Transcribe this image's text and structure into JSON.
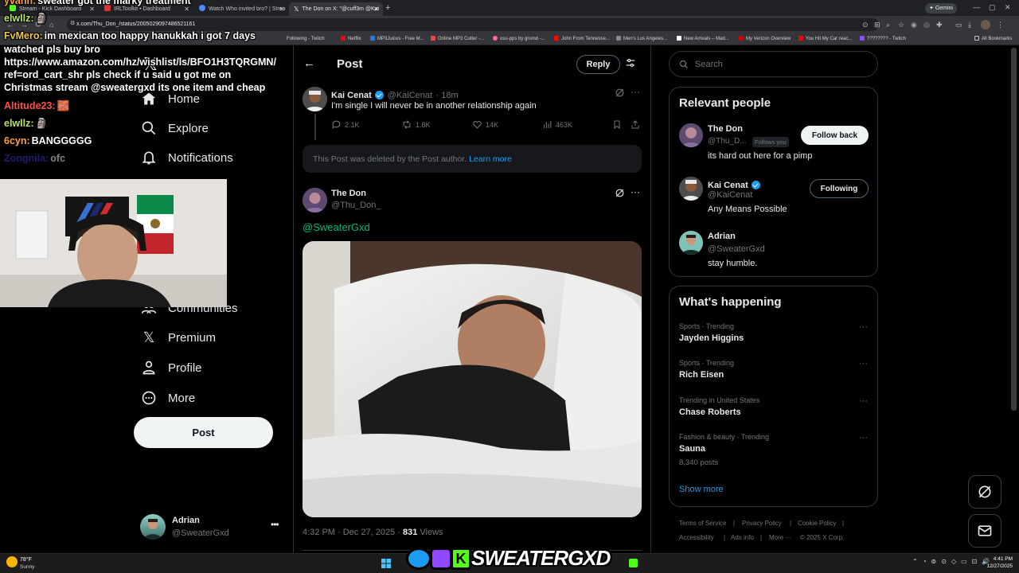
{
  "browser": {
    "tabs": [
      {
        "title": "Stream - Kick Dashboard",
        "color": "#53fc18"
      },
      {
        "title": "IRLToolkit • Dashboard",
        "color": "#e03131"
      },
      {
        "title": "Watch Who invited bro? | Strea",
        "color": "#4c8bf5"
      },
      {
        "title": "The Don on X: \"@cuff3m @Kai",
        "color": "#ffffff"
      }
    ],
    "new_tab": "+",
    "gemini_label": "Gemini",
    "url": "x.com/Thu_Don_/status/2005029097486521161",
    "bookmarks": [
      {
        "label": "Following - Twitch",
        "color": "#9146ff"
      },
      {
        "label": "Netflix",
        "color": "#e50914"
      },
      {
        "label": "MP3Juices - Free M...",
        "color": "#2b7bd6"
      },
      {
        "label": "Online MP3 Cutter -...",
        "color": "#e44"
      },
      {
        "label": "osu-pps by grumd -...",
        "color": "#ff66aa"
      },
      {
        "label": "John From Tennesse...",
        "color": "#ff0000"
      },
      {
        "label": "Men's Los Angeles...",
        "color": "#888888"
      },
      {
        "label": "New Arrivals – Mad...",
        "color": "#ffffff"
      },
      {
        "label": "My Verizon Overview",
        "color": "#cd040b"
      },
      {
        "label": "You Hit My Car reac...",
        "color": "#ff0000"
      },
      {
        "label": "???????? - Twitch",
        "color": "#9146ff"
      },
      {
        "label": "All Bookmarks",
        "color": "#bdc1c6"
      }
    ]
  },
  "chat": [
    {
      "user": "yvanh:",
      "user_color": "#ff9f43",
      "text": "sweater got the marky treatment"
    },
    {
      "user": "elwllz:",
      "user_color": "#b7e36b",
      "text": "🗿"
    },
    {
      "user": "FvMero:",
      "user_color": "#f2c94c",
      "text": "im mexican too happy hanukkah i got 7 days"
    },
    {
      "user": "",
      "user_color": "#ffffff",
      "text": "watched pls buy bro"
    },
    {
      "user": "",
      "user_color": "#ffffff",
      "text": "https://www.amazon.com/hz/wishlist/ls/BFO1H3TQRGMN/"
    },
    {
      "user": "",
      "user_color": "#ffffff",
      "text": "ref=ord_cart_shr pls check if u said u got me on"
    },
    {
      "user": "",
      "user_color": "#ffffff",
      "text": "Christmas stream @sweatergxd its one item and cheap"
    },
    {
      "user": "Altitude23:",
      "user_color": "#ff4d4d",
      "text": "🧱"
    },
    {
      "user": "elwllz:",
      "user_color": "#b7e36b",
      "text": "🗿"
    },
    {
      "user": "6cyn:",
      "user_color": "#ff9f43",
      "text": "BANGGGGG"
    },
    {
      "user": "Zongnila:",
      "user_color": "#3b3bd6",
      "text": "ofc"
    }
  ],
  "nav": {
    "home": "Home",
    "explore": "Explore",
    "notifications": "Notifications",
    "communities": "Communities",
    "premium": "Premium",
    "profile": "Profile",
    "more": "More",
    "post_button": "Post",
    "account_name": "Adrian",
    "account_handle": "@SweaterGxd"
  },
  "header": {
    "back": "←",
    "title": "Post",
    "reply_button": "Reply"
  },
  "quoted_tweet": {
    "name": "Kai Cenat",
    "handle": "@KaiCenat",
    "time": "· 18m",
    "text": "I'm single I will never be in another relationship again",
    "replies": "2.1K",
    "reposts": "1.8K",
    "likes": "14K",
    "views": "463K"
  },
  "deleted_notice": {
    "text": "This Post was deleted by the Post author.",
    "link": "Learn more"
  },
  "main_post": {
    "name": "The Don",
    "handle": "@Thu_Don_",
    "mention": "@SweaterGxd",
    "time": "4:32 PM · Dec 27, 2025 ·",
    "views_count": "831",
    "views_label": "Views"
  },
  "search": {
    "placeholder": "Search"
  },
  "relevant_people": {
    "title": "Relevant people",
    "people": [
      {
        "name": "The Don",
        "handle": "@Thu_D...",
        "badge": "Follows you",
        "bio": "its hard out here for a pimp",
        "button": "Follow back"
      },
      {
        "name": "Kai Cenat",
        "handle": "@KaiCenat",
        "bio": "Any Means Possible",
        "button": "Following"
      },
      {
        "name": "Adrian",
        "handle": "@SweaterGxd",
        "bio": "stay humble."
      }
    ]
  },
  "happening": {
    "title": "What's happening",
    "trends": [
      {
        "context": "Sports · Trending",
        "topic": "Jayden Higgins",
        "count": ""
      },
      {
        "context": "Sports · Trending",
        "topic": "Rich Eisen",
        "count": ""
      },
      {
        "context": "Trending in United States",
        "topic": "Chase Roberts",
        "count": ""
      },
      {
        "context": "Fashion & beauty · Trending",
        "topic": "Sauna",
        "count": "8,340 posts"
      }
    ],
    "show_more": "Show more"
  },
  "footer": {
    "links": [
      "Terms of Service",
      "Privacy Policy",
      "Cookie Policy",
      "Accessibility",
      "Ads info",
      "More ···"
    ],
    "copyright": "© 2025 X Corp."
  },
  "taskbar": {
    "weather_temp": "78°F",
    "weather_desc": "Sunny",
    "time": "4:41 PM",
    "date": "12/27/2025",
    "brand_overlay": "SWEATERGXD"
  },
  "colors": {
    "accent": "#1d9bf0",
    "link_green": "#00ba7c",
    "muted": "#71767b",
    "border": "#2f3336"
  }
}
